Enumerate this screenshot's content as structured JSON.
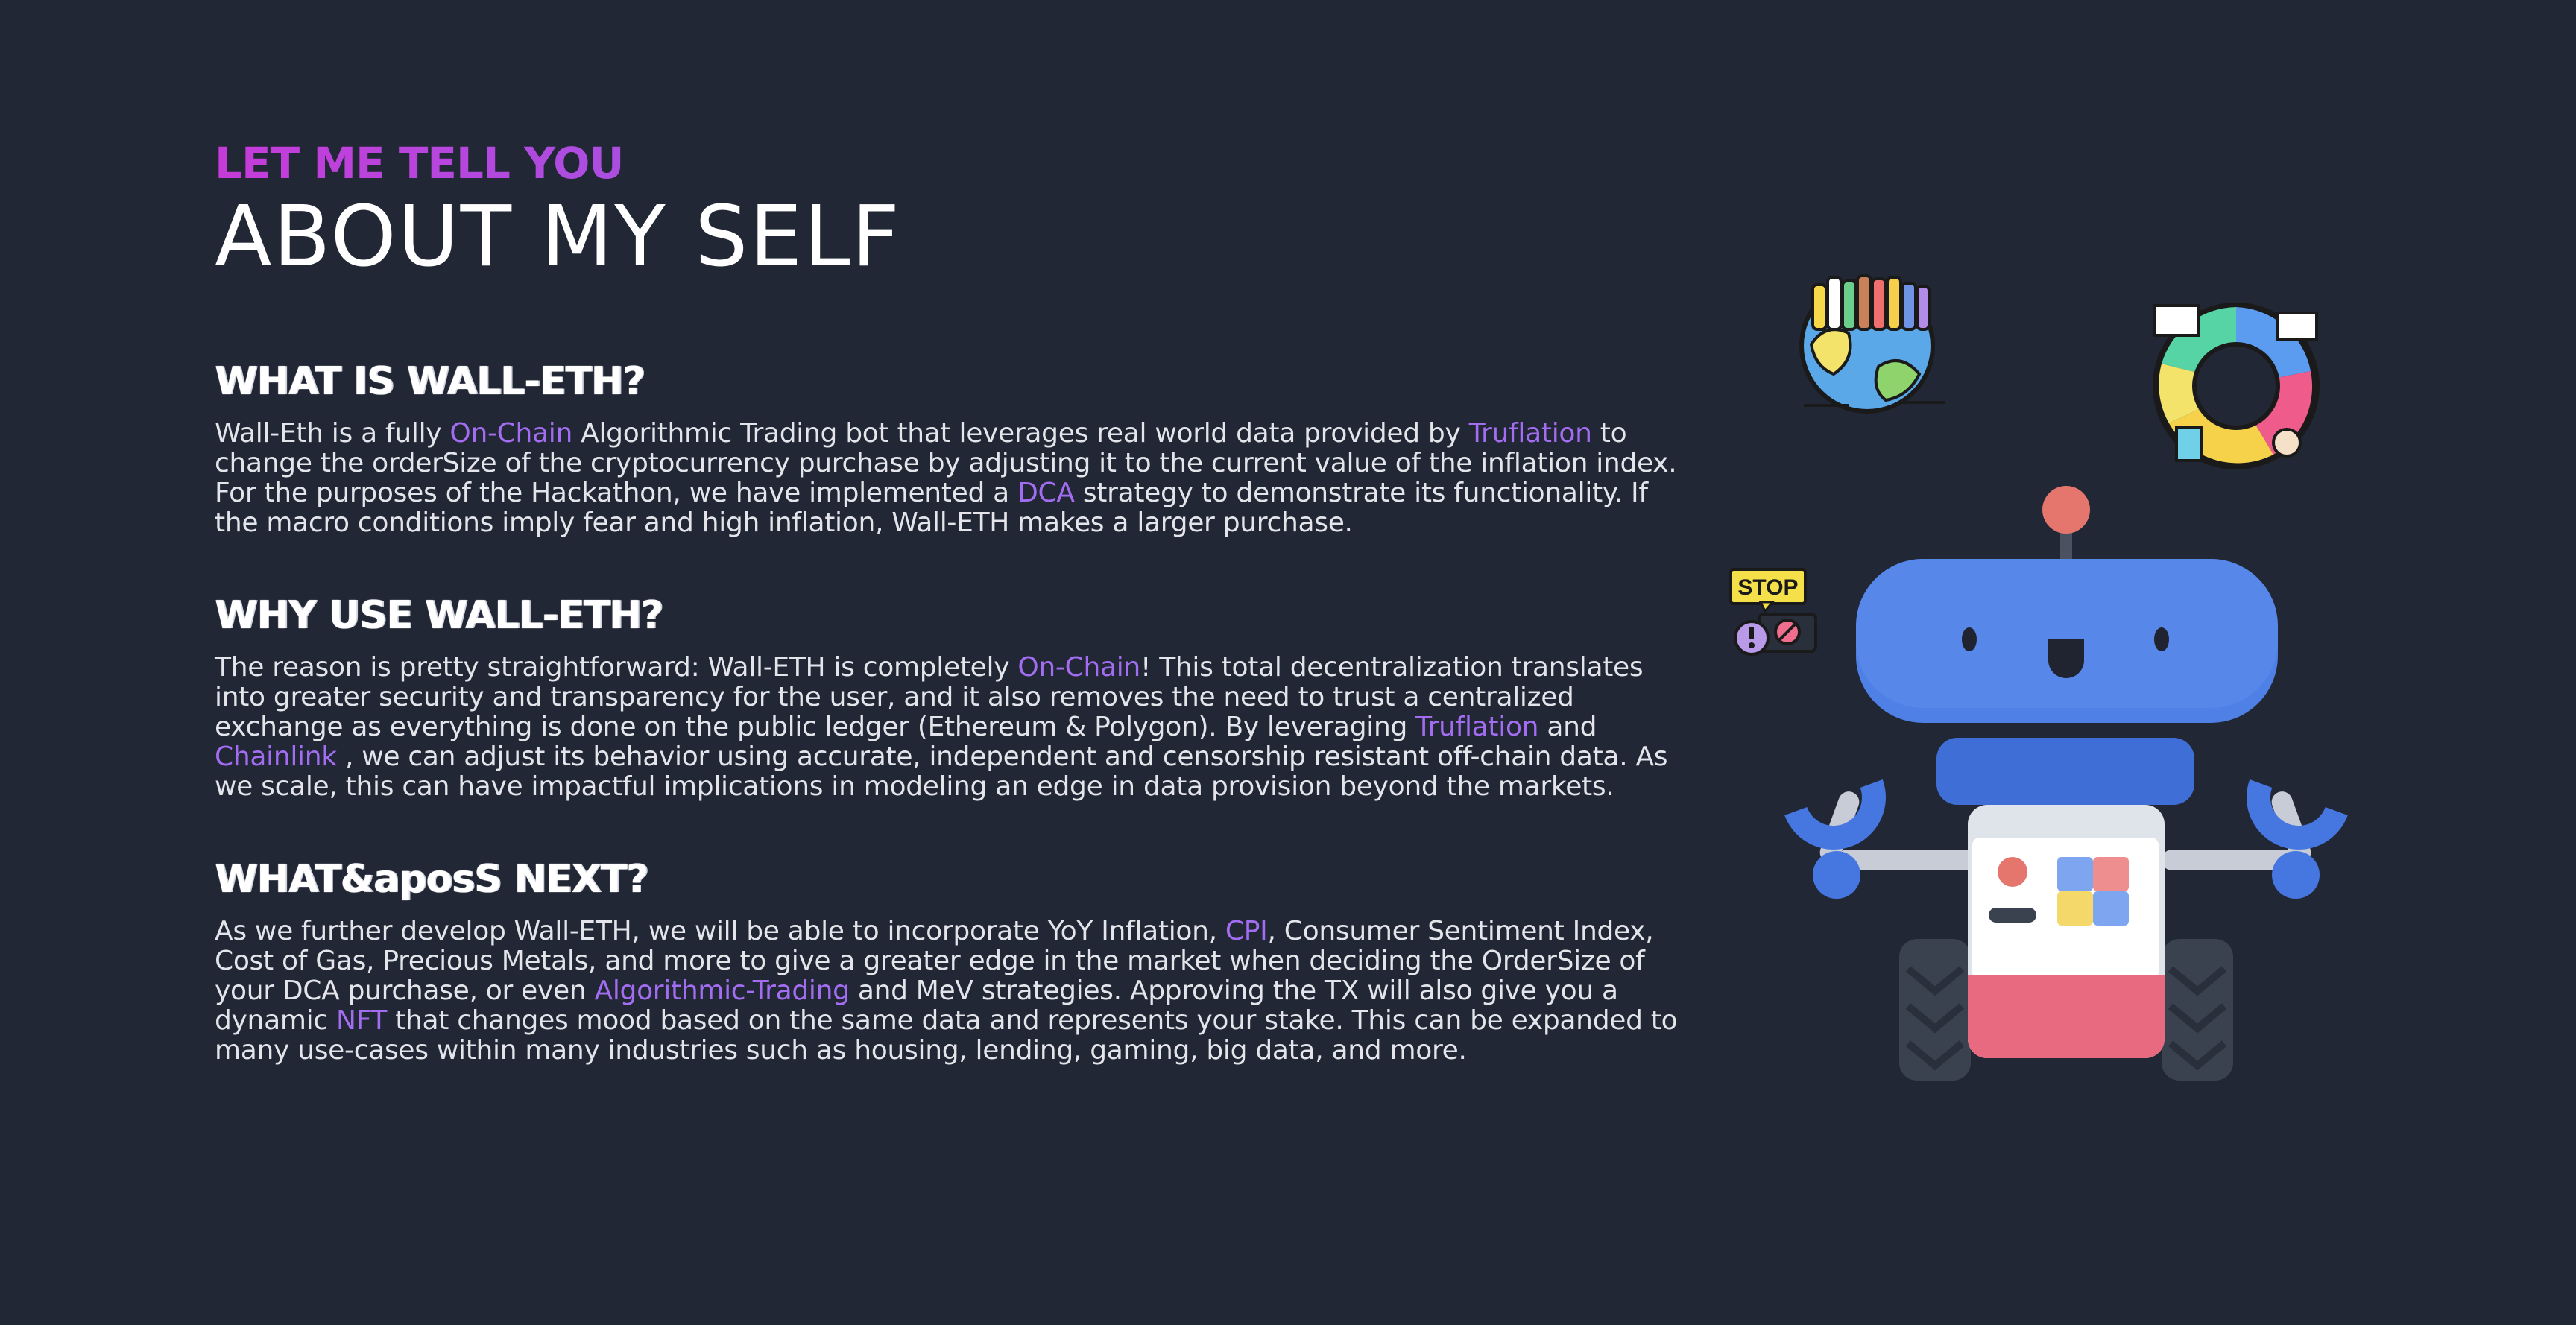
{
  "header": {
    "eyebrow": "LET ME TELL YOU",
    "title": "ABOUT MY SELF"
  },
  "sections": [
    {
      "heading": "WHAT IS WALL-ETH?",
      "parts": [
        {
          "t": "Wall-Eth is a fully ",
          "hl": false
        },
        {
          "t": "On-Chain",
          "hl": true
        },
        {
          "t": " Algorithmic Trading bot that leverages real world data provided by ",
          "hl": false
        },
        {
          "t": "Truflation",
          "hl": true
        },
        {
          "t": " to change the orderSize of the cryptocurrency purchase by adjusting it to the current value of the inflation index. For the purposes of the Hackathon, we have implemented a ",
          "hl": false
        },
        {
          "t": "DCA",
          "hl": true
        },
        {
          "t": " strategy to demonstrate its functionality. If the macro conditions imply fear and high inflation, Wall-ETH makes a larger purchase.",
          "hl": false
        }
      ]
    },
    {
      "heading": "WHY USE WALL-ETH?",
      "parts": [
        {
          "t": "The reason is pretty straightforward: Wall-ETH is completely ",
          "hl": false
        },
        {
          "t": "On-Chain",
          "hl": true
        },
        {
          "t": "! This total decentralization translates into greater security and transparency for the user, and it also removes the need to trust a centralized exchange as everything is done on the public ledger (Ethereum & Polygon). By leveraging ",
          "hl": false
        },
        {
          "t": "Truflation",
          "hl": true
        },
        {
          "t": " and ",
          "hl": false
        },
        {
          "t": "Chainlink",
          "hl": true
        },
        {
          "t": " , we can adjust its behavior using accurate, independent and censorship resistant off-chain data. As we scale, this can have impactful implications in modeling an edge in data provision beyond the markets.",
          "hl": false
        }
      ]
    },
    {
      "heading": "WHAT&aposS NEXT?",
      "parts": [
        {
          "t": "As we further develop Wall-ETH, we will be able to incorporate YoY Inflation, ",
          "hl": false
        },
        {
          "t": "CPI",
          "hl": true
        },
        {
          "t": ", Consumer Sentiment Index, Cost of Gas, Precious Metals, and more to give a greater edge in the market when deciding the OrderSize of your DCA purchase, or even ",
          "hl": false
        },
        {
          "t": "Algorithmic-Trading",
          "hl": true
        },
        {
          "t": " and MeV strategies. Approving the TX will also give you a dynamic ",
          "hl": false
        },
        {
          "t": "NFT",
          "hl": true
        },
        {
          "t": " that changes mood based on the same data and represents your stake. This can be expanded to many use-cases within many industries such as housing, lending, gaming, big data, and more.",
          "hl": false
        }
      ]
    }
  ],
  "illustrations": {
    "stop_sign_text": "STOP",
    "icons": [
      "globe-people-icon",
      "recycle-cycle-icon",
      "stop-alert-icon",
      "robot-illustration"
    ]
  },
  "colors": {
    "background": "#212735",
    "accent_purple": "#a36df2",
    "robot_blue": "#4a7ee2",
    "robot_head_light": "#e5766d"
  }
}
